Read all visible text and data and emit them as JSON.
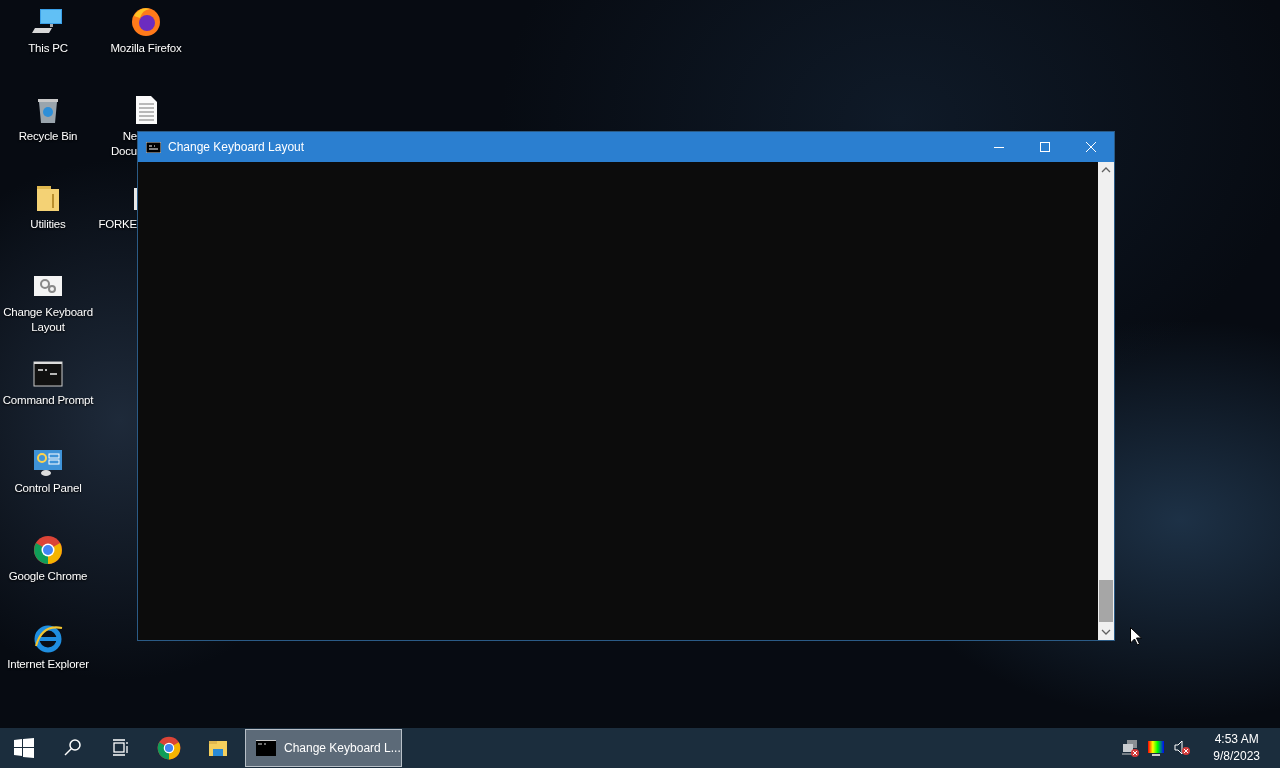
{
  "desktop_columns": [
    [
      {
        "label": "This PC",
        "kind": "computer"
      },
      {
        "label": "Recycle Bin",
        "kind": "bin"
      },
      {
        "label": "Utilities",
        "kind": "folder"
      },
      {
        "label": "Change Keyboard Layout",
        "kind": "settings"
      },
      {
        "label": "Command Prompt",
        "kind": "console"
      },
      {
        "label": "Control Panel",
        "kind": "panel"
      },
      {
        "label": "Google Chrome",
        "kind": "chrome"
      },
      {
        "label": "Internet Explorer",
        "kind": "ie"
      }
    ],
    [
      {
        "label": "Mozilla Firefox",
        "kind": "firefox"
      },
      {
        "label": "Ne Docu",
        "kind": "document"
      },
      {
        "label": "FORKE",
        "kind": "app"
      }
    ]
  ],
  "window": {
    "title": "Change Keyboard Layout"
  },
  "taskbar": {
    "pinned": [
      {
        "kind": "search"
      },
      {
        "kind": "taskview"
      },
      {
        "kind": "chrome"
      },
      {
        "kind": "explorer"
      }
    ],
    "open_windows": [
      {
        "label": "Change Keyboard L...",
        "selected": true
      }
    ],
    "time": "4:53 AM",
    "date": "9/8/2023"
  }
}
